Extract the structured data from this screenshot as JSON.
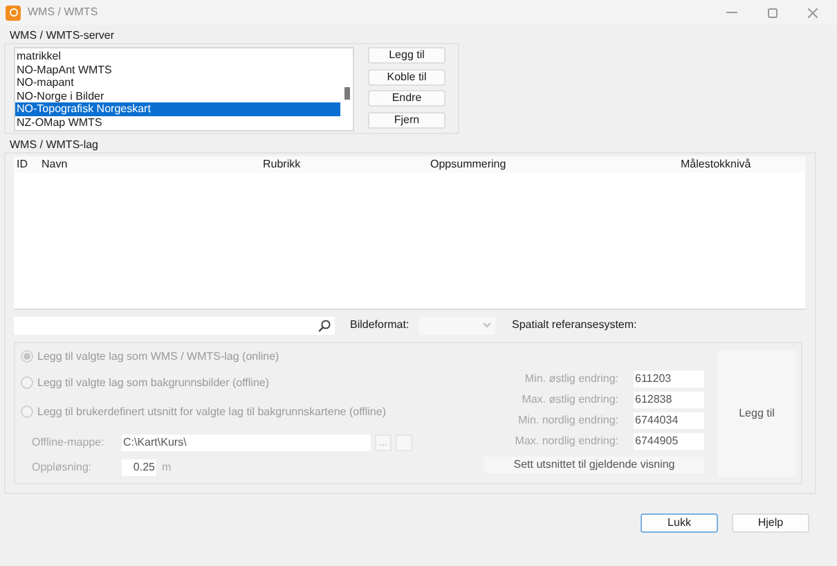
{
  "window": {
    "title": "WMS / WMTS"
  },
  "server_group": {
    "title": "WMS / WMTS-server",
    "servers": [
      {
        "label": "matrikkel",
        "selected": false
      },
      {
        "label": "NO-MapAnt WMTS",
        "selected": false
      },
      {
        "label": "NO-mapant",
        "selected": false
      },
      {
        "label": "NO-Norge i Bilder",
        "selected": false
      },
      {
        "label": "NO-Topografisk Norgeskart",
        "selected": true
      },
      {
        "label": "NZ-OMap WMTS",
        "selected": false
      }
    ],
    "buttons": [
      "Legg til",
      "Koble til",
      "Endre",
      "Fjern"
    ]
  },
  "layer_group": {
    "title": "WMS / WMTS-lag",
    "table": {
      "columns": [
        "ID",
        "Navn",
        "Rubrikk",
        "Oppsummering",
        "Målestokknivå"
      ]
    },
    "image_format_label": "Bildeformat:",
    "crs_label": "Spatialt referansesystem:",
    "options": [
      {
        "label": "Legg til valgte lag som WMS / WMTS-lag (online)",
        "selected": true,
        "disabled": true
      },
      {
        "label": "Legg til valgte lag som bakgrunnsbilder (offline)",
        "selected": false,
        "disabled": true
      },
      {
        "label": "Legg til brukerdefinert utsnitt for valgte lag til bakgrunnskartene (offline)",
        "selected": false,
        "disabled": true
      }
    ],
    "offline_folder": {
      "label": "Offline-mappe:",
      "value": "C:\\Kart\\Kurs\\",
      "browse_button": "..."
    },
    "resolution": {
      "label": "Oppløsning:",
      "value": "0.25",
      "unit": "m"
    },
    "extent": [
      {
        "label": "Min. østlig endring:",
        "value": "611203"
      },
      {
        "label": "Max. østlig endring:",
        "value": "612838"
      },
      {
        "label": "Min. nordlig endring:",
        "value": "6744034"
      },
      {
        "label": "Max. nordlig endring:",
        "value": "6744905"
      }
    ],
    "set_extent_button": "Sett utsnittet til gjeldende visning",
    "add_button": "Legg til"
  },
  "footer_buttons": [
    {
      "label": "Lukk",
      "selected": true
    },
    {
      "label": "Hjelp",
      "selected": false
    }
  ]
}
